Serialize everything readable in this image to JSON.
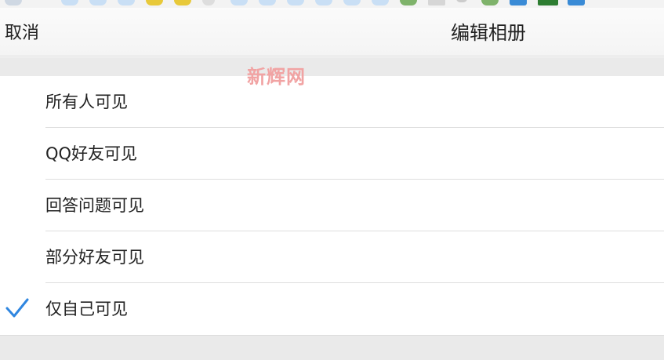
{
  "header": {
    "cancel_label": "取消",
    "title": "编辑相册"
  },
  "watermark": "新辉网",
  "visibility_options": [
    {
      "label": "所有人可见",
      "selected": false
    },
    {
      "label": "QQ好友可见",
      "selected": false
    },
    {
      "label": "回答问题可见",
      "selected": false
    },
    {
      "label": "部分好友可见",
      "selected": false
    },
    {
      "label": "仅自己可见",
      "selected": true
    }
  ],
  "colors": {
    "check": "#2f86e0",
    "watermark": "#f1a3a3"
  },
  "status_icons": [
    "app-icon",
    "cloud-icon",
    "cloud-icon",
    "cloud-icon",
    "smiley-icon",
    "smiley-icon",
    "heart-icon",
    "cloud-icon",
    "cloud-icon",
    "cloud-icon",
    "cloud-icon",
    "cloud-icon",
    "cloud-icon",
    "app-icon",
    "app-icon",
    "minus-icon",
    "app-icon",
    "cube-icon",
    "battery-icon",
    "cube-icon"
  ]
}
